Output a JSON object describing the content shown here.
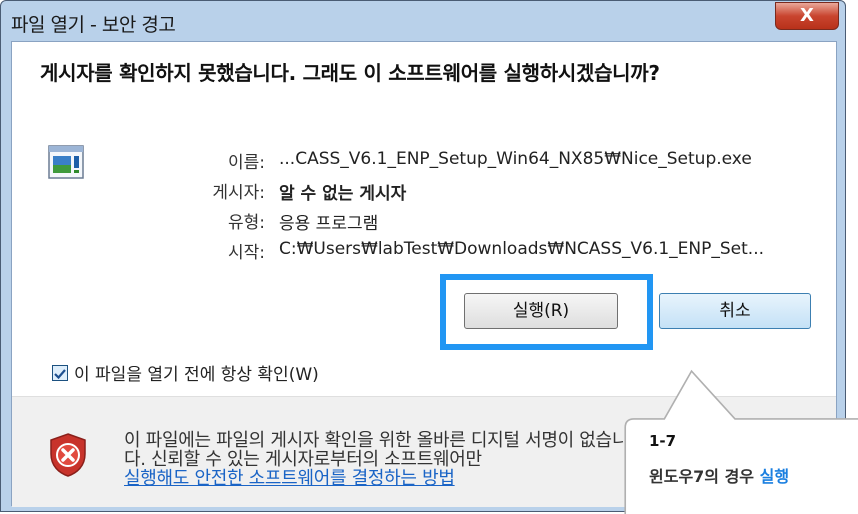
{
  "window": {
    "title": "파일 열기 - 보안 경고",
    "close_label": "X"
  },
  "dialog": {
    "headline": "게시자를 확인하지 못했습니다. 그래도 이 소프트웨어를 실행하시겠습니까?",
    "fields": [
      {
        "label": "이름:",
        "value": "...CASS_V6.1_ENP_Setup_Win64_NX85₩Nice_Setup.exe"
      },
      {
        "label": "게시자:",
        "value": "알 수 없는 게시자"
      },
      {
        "label": "유형:",
        "value": "응용 프로그램"
      },
      {
        "label": "시작:",
        "value": "C:₩Users₩labTest₩Downloads₩NCASS_V6.1_ENP_Set..."
      }
    ],
    "run_button": "실행(R)",
    "cancel_button": "취소",
    "checkbox_label": "이 파일을 열기 전에 항상 확인(W)",
    "checkbox_checked": true,
    "footer_text": "이 파일에는 파일의 게시자 확인을 위한 올바른 디지털 서명이 없습니다. 신뢰할 수 있는 게시자로부터의 소프트웨어만",
    "footer_link": "실행해도 안전한 소프트웨어를 결정하는 방법"
  },
  "annotation": {
    "number": "1-7",
    "text_prefix": "윈도우7의 경우 ",
    "text_highlight": "실행",
    "highlight_color": "#2196f3"
  }
}
